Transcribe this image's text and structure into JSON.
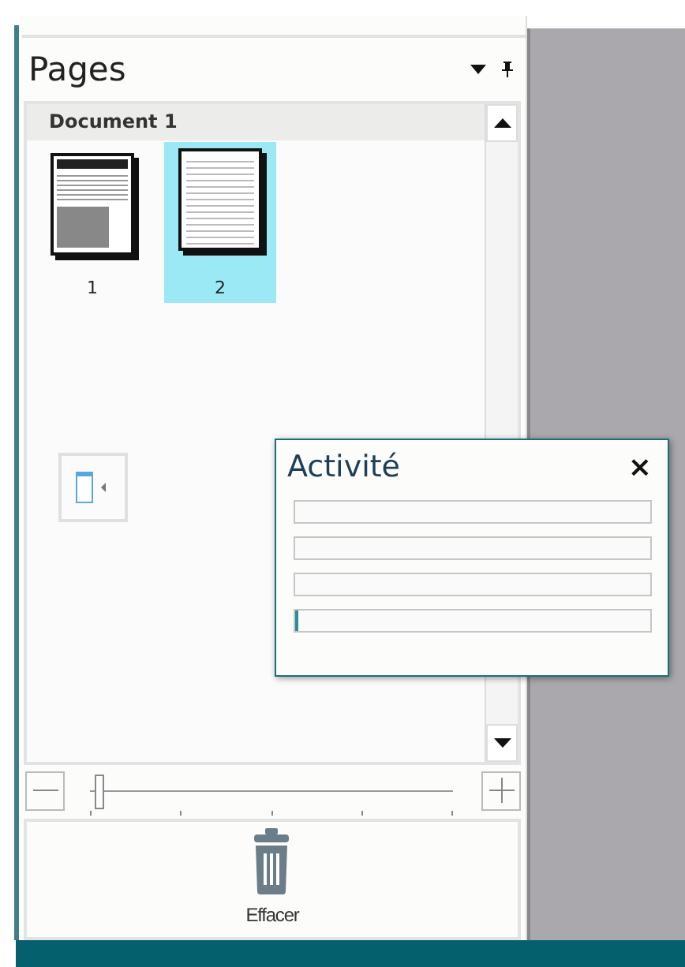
{
  "panel": {
    "title": "Pages"
  },
  "document": {
    "title": "Document 1",
    "pages": [
      {
        "label": "1",
        "kind": "article",
        "selected": false
      },
      {
        "label": "2",
        "kind": "form",
        "selected": true
      }
    ]
  },
  "zoom": {
    "level": 0.02
  },
  "delete_button": {
    "label": "Effacer"
  },
  "activity": {
    "title": "Activité",
    "close": "×",
    "bars": [
      {
        "level": 0
      },
      {
        "level": 0
      },
      {
        "level": 0
      },
      {
        "level": 0.01
      }
    ]
  }
}
